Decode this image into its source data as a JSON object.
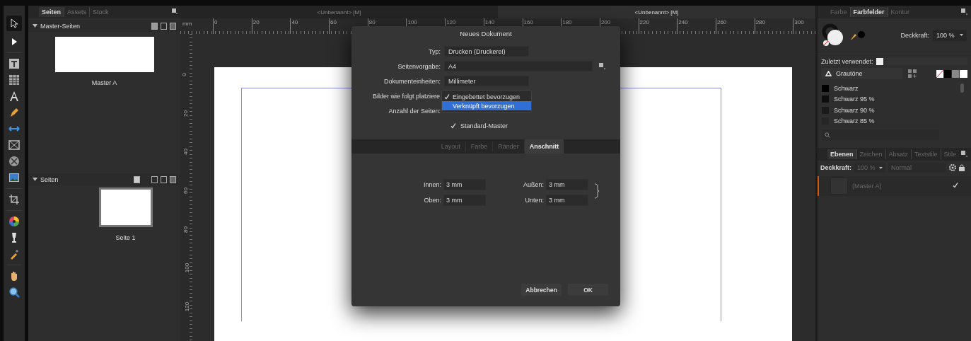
{
  "pages_panel": {
    "tabs": [
      {
        "label": "Seiten",
        "selected": true
      },
      {
        "label": "Assets",
        "selected": false
      },
      {
        "label": "Stock",
        "selected": false
      }
    ],
    "master_section": {
      "title": "Master-Seiten",
      "expanded": true,
      "items": [
        {
          "label": "Master A"
        }
      ]
    },
    "pages_section": {
      "title": "Seiten",
      "expanded": true,
      "items": [
        {
          "label": "Seite 1"
        }
      ]
    }
  },
  "document_tabs": [
    {
      "label": "<Unbenannt> [M]",
      "selected": false
    },
    {
      "label": "<Unbenannt> [M]",
      "selected": true
    }
  ],
  "ruler": {
    "unit": "mm",
    "horizontal": [
      "0",
      "20",
      "40",
      "60",
      "80",
      "100",
      "120",
      "140",
      "160",
      "180",
      "200",
      "220",
      "240",
      "260",
      "280",
      "300"
    ],
    "vertical": [
      "0",
      "20",
      "40",
      "60",
      "80",
      "100",
      "120"
    ]
  },
  "dialog": {
    "title": "Neues Dokument",
    "fields": [
      {
        "label": "Typ:",
        "value": "Drucken (Druckerei)"
      },
      {
        "label": "Seitenvorgabe:",
        "value": "A4"
      },
      {
        "label": "Dokumenteinheiten:",
        "value": "Millimeter"
      }
    ],
    "placement": {
      "label": "Bilder wie folgt platziere",
      "options": [
        {
          "label": "Eingebettet bevorzugen",
          "checked": true,
          "selected": false
        },
        {
          "label": "Verknüpft bevorzugen",
          "checked": false,
          "selected": true
        }
      ]
    },
    "page_count": {
      "label": "Anzahl der Seiten:"
    },
    "standard_master": {
      "label": "Standard-Master",
      "checked": true
    },
    "tabs": [
      {
        "label": "Layout",
        "selected": false
      },
      {
        "label": "Farbe",
        "selected": false
      },
      {
        "label": "Ränder",
        "selected": false
      },
      {
        "label": "Anschnitt",
        "selected": true
      }
    ],
    "bleed": [
      {
        "label": "Innen:",
        "value": "3 mm"
      },
      {
        "label": "Außen:",
        "value": "3 mm"
      },
      {
        "label": "Oben:",
        "value": "3 mm"
      },
      {
        "label": "Unten:",
        "value": "3 mm"
      }
    ],
    "buttons": [
      "Abbrechen",
      "OK"
    ]
  },
  "swatches_panel": {
    "tabs": [
      {
        "label": "Farbe",
        "selected": false
      },
      {
        "label": "Farbfelder",
        "selected": true
      },
      {
        "label": "Kontur",
        "selected": false
      }
    ],
    "opacity_label": "Deckkraft:",
    "opacity_value": "100 %",
    "recent_label": "Zuletzt verwendet:",
    "palette": "Grautöne",
    "swatches": [
      {
        "name": "Schwarz",
        "color": "#000000"
      },
      {
        "name": "Schwarz 95 %",
        "color": "#0d0d0d"
      },
      {
        "name": "Schwarz 90 %",
        "color": "#1a1a1a"
      },
      {
        "name": "Schwarz 85 %",
        "color": "#262626"
      }
    ]
  },
  "layers_panel": {
    "tabs": [
      {
        "label": "Ebenen",
        "selected": true
      },
      {
        "label": "Zeichen",
        "selected": false
      },
      {
        "label": "Absatz",
        "selected": false
      },
      {
        "label": "Textstile",
        "selected": false
      },
      {
        "label": "Stile",
        "selected": false
      }
    ],
    "opacity_label": "Deckkraft:",
    "opacity_value": "100 %",
    "blend_mode": "Normal",
    "disabled": true,
    "layers": [
      {
        "name": "(Master A)",
        "visible": true
      }
    ]
  }
}
